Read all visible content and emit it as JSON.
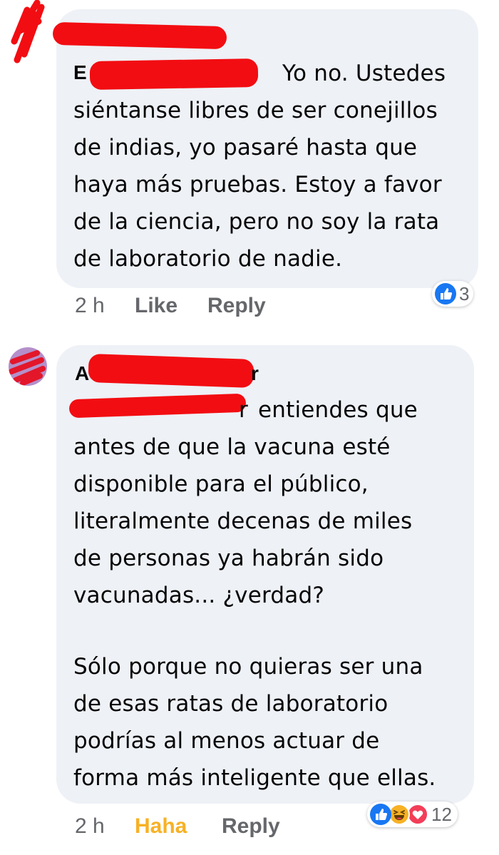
{
  "comments": [
    {
      "author_visible": "E",
      "text_lines": [
        "Yo no. Ustedes",
        "siéntanse libres de ser conejillos",
        "de indias, yo pasaré hasta que",
        "haya más pruebas. Estoy a favor",
        "de la ciencia, pero no soy la rata",
        "de laboratorio de nadie."
      ],
      "time": "2 h",
      "action_label": "Like",
      "reply_label": "Reply",
      "reactions": [
        "like-icon"
      ],
      "reaction_count": "3"
    },
    {
      "author_visible": "A",
      "author_tail": "r",
      "mention_tail": "r",
      "text_lines": [
        "entiendes que",
        "antes de que la vacuna esté",
        "disponible para el público,",
        "literalmente decenas de miles",
        "de personas ya habrán sido",
        "vacunadas... ¿verdad?",
        "",
        "Sólo porque no quieras ser una",
        "de esas ratas de laboratorio",
        "podrías al menos actuar de",
        "forma más inteligente que ellas."
      ],
      "time": "2 h",
      "action_label": "Haha",
      "reply_label": "Reply",
      "reactions": [
        "like-icon",
        "haha-icon",
        "love-icon"
      ],
      "reaction_count": "12"
    }
  ],
  "colors": {
    "bubble": "#eef1f6",
    "redaction": "#f20d12",
    "like_blue": "#1877f2",
    "haha_yellow": "#f7b125",
    "love_red": "#f33e58",
    "meta_gray": "#65676b"
  }
}
